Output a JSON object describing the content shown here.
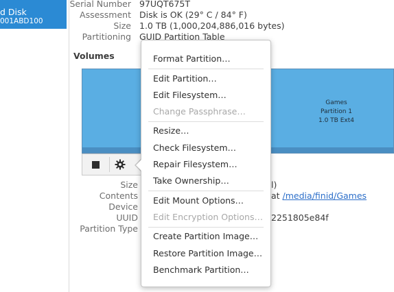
{
  "sidebar": {
    "disk_name": "d Disk",
    "disk_id": "001ABD100"
  },
  "disk_props": {
    "serial": {
      "label": "Serial Number",
      "value": "97UQT675T"
    },
    "assessment": {
      "label": "Assessment",
      "value": "Disk is OK (29° C / 84° F)"
    },
    "size": {
      "label": "Size",
      "value": "1.0 TB (1,000,204,886,016 bytes)"
    },
    "partitioning": {
      "label": "Partitioning",
      "value": "GUID Partition Table"
    }
  },
  "volumes": {
    "title": "Volumes",
    "partition": {
      "name": "Games",
      "number": "Partition 1",
      "size_type": "1.0 TB Ext4"
    }
  },
  "volume_props": {
    "size": {
      "label": "Size",
      "value_tail": "l)"
    },
    "contents": {
      "label": "Contents",
      "value_prefix": "at",
      "link": "/media/finid/Games"
    },
    "device": {
      "label": "Device"
    },
    "uuid": {
      "label": "UUID",
      "value_tail": "2251805e84f"
    },
    "partition_type": {
      "label": "Partition Type"
    }
  },
  "menu": {
    "items": [
      {
        "label": "Format Partition…",
        "enabled": true
      },
      {
        "label": "Edit Partition…",
        "enabled": true
      },
      {
        "label": "Edit Filesystem…",
        "enabled": true
      },
      {
        "label": "Change Passphrase…",
        "enabled": false
      },
      {
        "label": "Resize…",
        "enabled": true
      },
      {
        "label": "Check Filesystem…",
        "enabled": true
      },
      {
        "label": "Repair Filesystem…",
        "enabled": true
      },
      {
        "label": "Take Ownership…",
        "enabled": true
      },
      {
        "label": "Edit Mount Options…",
        "enabled": true
      },
      {
        "label": "Edit Encryption Options…",
        "enabled": false
      },
      {
        "label": "Create Partition Image…",
        "enabled": true
      },
      {
        "label": "Restore Partition Image…",
        "enabled": true
      },
      {
        "label": "Benchmark Partition…",
        "enabled": true
      }
    ]
  },
  "colors": {
    "selection": "#2b8ad4",
    "partition_fill": "#5aaee3",
    "link": "#2b6ec9",
    "disabled_text": "#a8a8a8"
  },
  "icons": {
    "stop": "stop-square-icon",
    "settings": "gear-icon"
  }
}
